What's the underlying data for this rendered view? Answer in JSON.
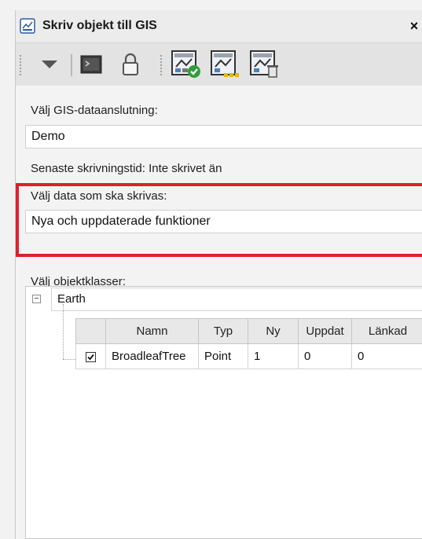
{
  "window": {
    "title": "Skriv objekt till GIS",
    "close_label": "×"
  },
  "toolbar": {
    "items": [
      {
        "name": "dropdown-arrow-icon"
      },
      {
        "name": "console-icon"
      },
      {
        "name": "lock-icon"
      },
      {
        "name": "write-check-icon"
      },
      {
        "name": "write-update-icon"
      },
      {
        "name": "write-delete-icon"
      }
    ]
  },
  "connection": {
    "label": "Välj GIS-dataanslutning:",
    "value": "Demo"
  },
  "last_write": {
    "text": "Senaste skrivningstid: Inte skrivet än"
  },
  "data_select": {
    "label": "Välj data som ska skrivas:",
    "value": "Nya och uppdaterade funktioner"
  },
  "classes": {
    "label": "Välj objektklasser:",
    "tree": {
      "expander": "−",
      "root": "Earth",
      "columns": [
        "",
        "Namn",
        "Typ",
        "Ny",
        "Uppdat",
        "Länkad"
      ],
      "rows": [
        {
          "checked": true,
          "name": "BroadleafTree",
          "type": "Point",
          "new": "1",
          "updated": "0",
          "linked": "0"
        }
      ]
    }
  },
  "colors": {
    "highlight_border": "#e0202a",
    "accent_green": "#2e9e3a",
    "accent_yellow": "#f0b400"
  }
}
